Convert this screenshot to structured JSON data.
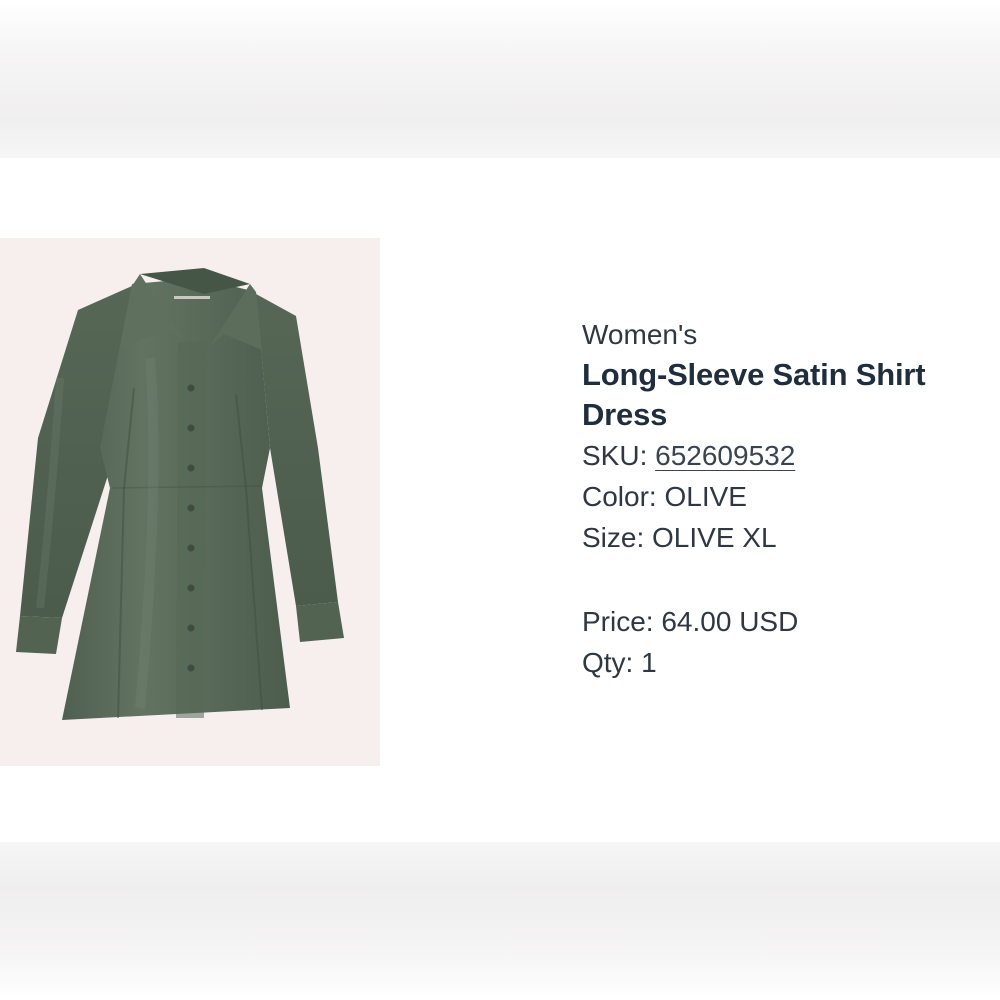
{
  "product": {
    "category": "Women's",
    "title_line1": "Long-Sleeve Satin Shirt",
    "title_line2": "Dress",
    "sku_label": "SKU:",
    "sku_value": "652609532",
    "color_label": "Color:",
    "color_value": "OLIVE",
    "size_label": "Size:",
    "size_value": "OLIVE XL",
    "price_label": "Price:",
    "price_value": "64.00 USD",
    "qty_label": "Qty:",
    "qty_value": "1"
  },
  "image": {
    "subject": "olive long-sleeve satin shirt dress",
    "dress_color": "#5a6b5b",
    "background_color": "#f7efee"
  },
  "colors": {
    "title": "#1f2d3d",
    "text": "#2f3842"
  }
}
